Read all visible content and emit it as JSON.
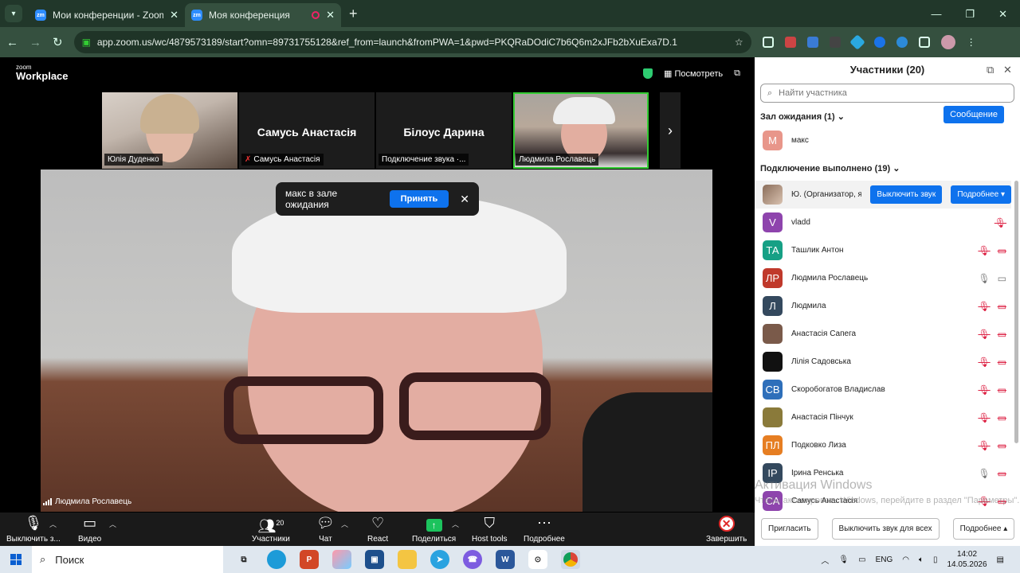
{
  "browser": {
    "tabs": [
      {
        "title": "Мои конференции - Zoom",
        "icon": "zm"
      },
      {
        "title": "Моя конференция",
        "icon": "zm",
        "recording": true
      }
    ],
    "url": "app.zoom.us/wc/4879573189/start?omn=89731755128&ref_from=launch&fromPWA=1&pwd=PKQRaDOdiC7b6Q6m2xJFb2bXuExa7D.1"
  },
  "zoom": {
    "logo_top": "zoom",
    "logo_bottom": "Workplace",
    "view_label": "Посмотреть",
    "strip": [
      {
        "label": "Юлія Дуденко",
        "kind": "video"
      },
      {
        "center": "Самусь Анастасія",
        "label": "Самусь Анастасія",
        "muted": true
      },
      {
        "center": "Білоус Дарина",
        "label": "Подключение звука ·..."
      },
      {
        "label": "Людмила Рославець",
        "kind": "video",
        "speaking": true
      }
    ],
    "waiting_banner": {
      "text": "макс в зале ожидания",
      "accept": "Принять"
    },
    "main_speaker": "Людмила Рославець",
    "toolbar": {
      "mute": "Выключить з...",
      "video": "Видео",
      "participants": "Участники",
      "participants_count": "20",
      "chat": "Чат",
      "react": "React",
      "share": "Поделиться",
      "host_tools": "Host tools",
      "more": "Подробнее",
      "end": "Завершить"
    }
  },
  "panel": {
    "title": "Участники (20)",
    "search_placeholder": "Найти участника",
    "waiting_header": "Зал ожидания (1)",
    "message_button": "Сообщение",
    "waiting": [
      {
        "initials": "М",
        "name": "макс",
        "color": "#e8968a"
      }
    ],
    "connected_header": "Подключение выполнено (19)",
    "host": {
      "name": "Ю. (Организатор, я)",
      "mute_button": "Выключить звук",
      "more_button": "Подробнее"
    },
    "participants": [
      {
        "initials": "V",
        "name": "vladd",
        "color": "#8e44ad",
        "mic": "muted",
        "cam": "none"
      },
      {
        "initials": "ТА",
        "name": "Ташлик Антон",
        "color": "#16a085",
        "mic": "muted",
        "cam": "off"
      },
      {
        "initials": "ЛР",
        "name": "Людмила Рославець",
        "color": "#c0392b",
        "mic": "on",
        "cam": "on"
      },
      {
        "initials": "Л",
        "name": "Людмила",
        "color": "#34495e",
        "mic": "muted",
        "cam": "off"
      },
      {
        "initials": "",
        "name": "Анастасія Сапега",
        "color": "#7a5a4a",
        "mic": "muted",
        "cam": "off"
      },
      {
        "initials": "",
        "name": "Лілія Садовська",
        "color": "#111111",
        "mic": "muted",
        "cam": "off"
      },
      {
        "initials": "СВ",
        "name": "Скоробогатов Владислав",
        "color": "#2e6fba",
        "mic": "muted",
        "cam": "off"
      },
      {
        "initials": "",
        "name": "Анастасія Пінчук",
        "color": "#8a7a3a",
        "mic": "muted",
        "cam": "off"
      },
      {
        "initials": "ПЛ",
        "name": "Подковко Лиза",
        "color": "#e67e22",
        "mic": "muted",
        "cam": "off"
      },
      {
        "initials": "ІР",
        "name": "Ірина Ренська",
        "color": "#34495e",
        "mic": "on",
        "cam": "off"
      },
      {
        "initials": "СА",
        "name": "Самусь Анастасія",
        "color": "#8e44ad",
        "mic": "muted",
        "cam": "off"
      }
    ],
    "footer": {
      "invite": "Пригласить",
      "mute_all": "Выключить звук для всех",
      "more": "Подробнее"
    },
    "watermark_title": "Активация Windows",
    "watermark_sub": "Чтобы активировать Windows, перейдите в раздел \"Параметры\"."
  },
  "taskbar": {
    "search": "Поиск",
    "lang": "ENG",
    "time": "14:02",
    "date": "14.05.2026"
  }
}
